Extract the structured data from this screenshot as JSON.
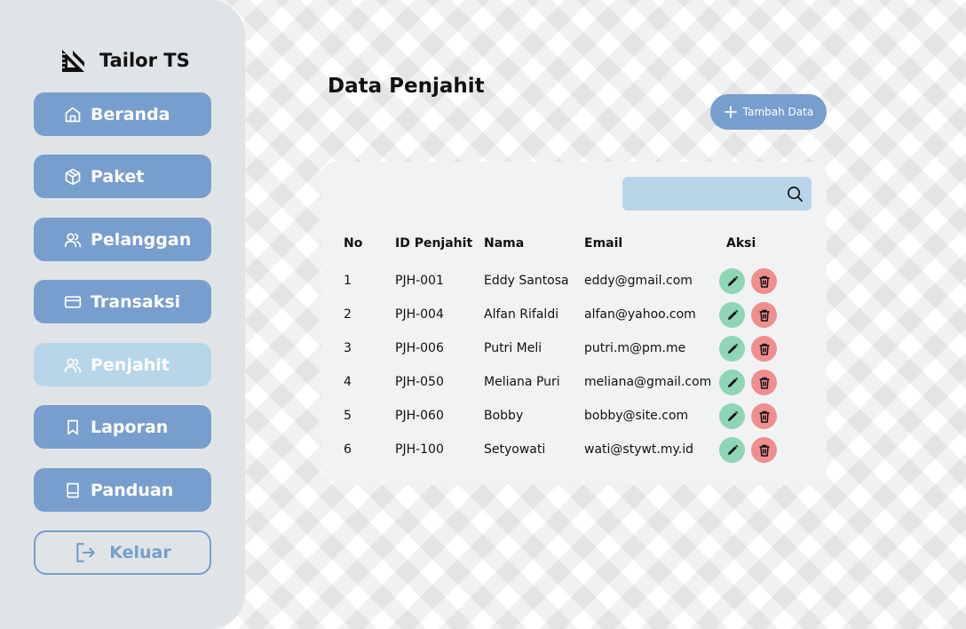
{
  "brand": {
    "name": "Tailor TS",
    "logo_icon": "tailor-ruler-icon"
  },
  "sidebar": {
    "items": [
      {
        "label": "Beranda",
        "icon": "home-icon",
        "active": false
      },
      {
        "label": "Paket",
        "icon": "package-icon",
        "active": false
      },
      {
        "label": "Pelanggan",
        "icon": "users-icon",
        "active": false
      },
      {
        "label": "Transaksi",
        "icon": "card-icon",
        "active": false
      },
      {
        "label": "Penjahit",
        "icon": "users-icon",
        "active": true
      },
      {
        "label": "Laporan",
        "icon": "bookmark-icon",
        "active": false
      },
      {
        "label": "Panduan",
        "icon": "book-icon",
        "active": false
      }
    ],
    "logout_label": "Keluar"
  },
  "page": {
    "title": "Data Penjahit",
    "add_button_label": "Tambah Data"
  },
  "search": {
    "placeholder": ""
  },
  "table": {
    "headers": {
      "no": "No",
      "id": "ID Penjahit",
      "name": "Nama",
      "email": "Email",
      "action": "Aksi"
    },
    "rows": [
      {
        "no": "1",
        "id": "PJH-001",
        "name": "Eddy Santosa",
        "email": "eddy@gmail.com"
      },
      {
        "no": "2",
        "id": "PJH-004",
        "name": "Alfan Rifaldi",
        "email": "alfan@yahoo.com"
      },
      {
        "no": "3",
        "id": "PJH-006",
        "name": "Putri Meli",
        "email": "putri.m@pm.me"
      },
      {
        "no": "4",
        "id": "PJH-050",
        "name": "Meliana Puri",
        "email": "meliana@gmail.com"
      },
      {
        "no": "5",
        "id": "PJH-060",
        "name": "Bobby",
        "email": "bobby@site.com"
      },
      {
        "no": "6",
        "id": "PJH-100",
        "name": "Setyowati",
        "email": "wati@stywt.my.id"
      }
    ]
  },
  "colors": {
    "primary": "#779ecd",
    "active": "#b8d6ea",
    "sidebar_bg": "#e0e4e6",
    "edit": "#8ed6b6",
    "delete": "#f08e8e"
  }
}
